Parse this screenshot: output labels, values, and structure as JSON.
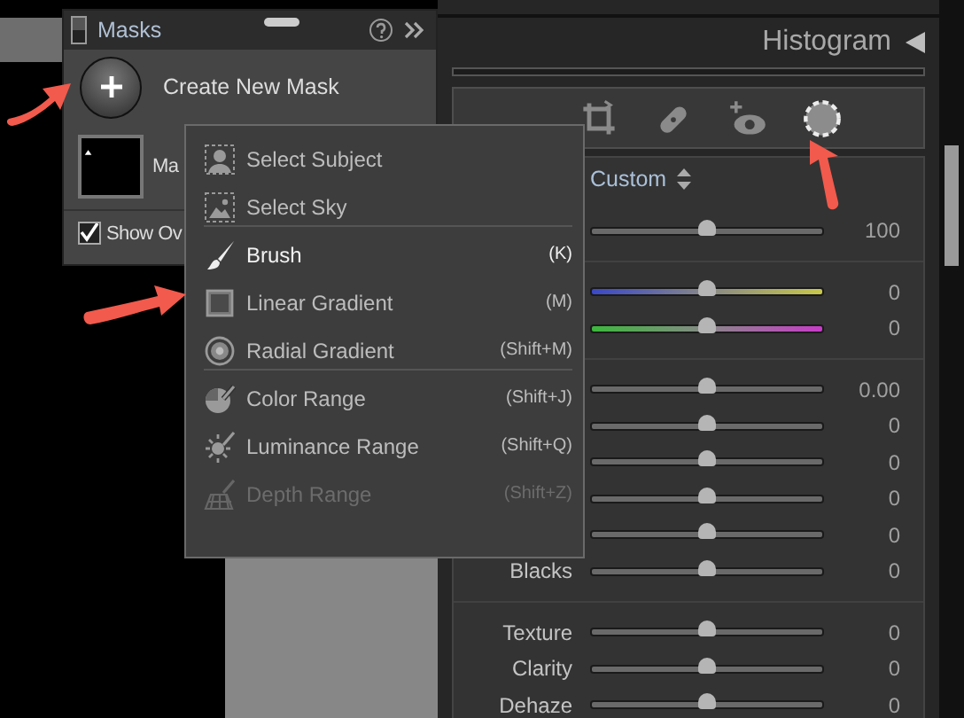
{
  "masks_panel": {
    "title": "Masks",
    "create_label": "Create New Mask",
    "mask_name": "Ma",
    "show_overlay": {
      "label": "Show Ov",
      "checked": true
    }
  },
  "mask_menu": {
    "sections": [
      [
        {
          "kind": "subject",
          "label": "Select Subject",
          "disabled": false,
          "selected": false
        },
        {
          "kind": "sky",
          "label": "Select Sky",
          "disabled": false,
          "selected": false
        }
      ],
      [
        {
          "kind": "brush",
          "label": "Brush",
          "shortcut": "(K)",
          "disabled": false,
          "selected": true
        },
        {
          "kind": "linear",
          "label": "Linear Gradient",
          "shortcut": "(M)",
          "disabled": false,
          "selected": false
        },
        {
          "kind": "radial",
          "label": "Radial Gradient",
          "shortcut": "(Shift+M)",
          "disabled": false,
          "selected": false
        }
      ],
      [
        {
          "kind": "color",
          "label": "Color Range",
          "shortcut": "(Shift+J)",
          "disabled": false,
          "selected": false
        },
        {
          "kind": "luminance",
          "label": "Luminance Range",
          "shortcut": "(Shift+Q)",
          "disabled": false,
          "selected": false
        },
        {
          "kind": "depth",
          "label": "Depth Range",
          "shortcut": "(Shift+Z)",
          "disabled": true,
          "selected": false
        }
      ]
    ]
  },
  "right_panel": {
    "title": "Histogram",
    "tools": [
      {
        "kind": "crop",
        "selected": false
      },
      {
        "kind": "heal",
        "selected": false
      },
      {
        "kind": "redeye",
        "selected": false
      },
      {
        "kind": "mask",
        "selected": true
      }
    ],
    "preset": "Custom",
    "slider_groups": [
      [
        {
          "kind": "plain",
          "value": "100",
          "level": 0.5
        }
      ],
      [
        {
          "kind": "temp",
          "value": "0",
          "level": 0.5
        },
        {
          "kind": "tint",
          "value": "0",
          "level": 0.5
        }
      ],
      [
        {
          "kind": "plain",
          "value": "0.00",
          "level": 0.5
        },
        {
          "kind": "plain",
          "value": "0",
          "level": 0.5
        },
        {
          "kind": "plain",
          "value": "0",
          "level": 0.5
        },
        {
          "kind": "plain",
          "value": "0",
          "level": 0.5
        },
        {
          "kind": "plain",
          "value": "0",
          "level": 0.5
        },
        {
          "kind": "plain",
          "label": "Blacks",
          "value": "0",
          "level": 0.5
        }
      ],
      [
        {
          "kind": "plain",
          "label": "Texture",
          "value": "0",
          "level": 0.5
        },
        {
          "kind": "plain",
          "label": "Clarity",
          "value": "0",
          "level": 0.5
        },
        {
          "kind": "plain",
          "label": "Dehaze",
          "value": "0",
          "level": 0.5
        }
      ]
    ]
  }
}
